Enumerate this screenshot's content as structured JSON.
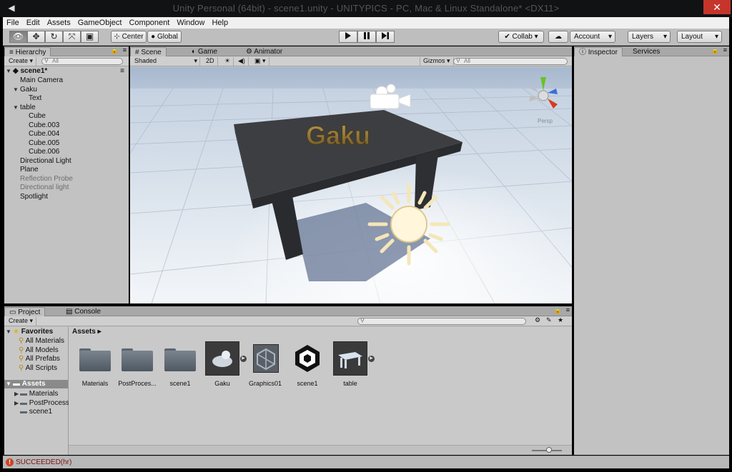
{
  "window": {
    "title": "Unity Personal (64bit) - scene1.unity - UNITYPICS - PC, Mac & Linux Standalone* <DX11>",
    "close_glyph": "✕",
    "app_icon": "unity-icon"
  },
  "menu": [
    "File",
    "Edit",
    "Assets",
    "GameObject",
    "Component",
    "Window",
    "Help"
  ],
  "toolbar": {
    "tools": [
      "hand-icon",
      "move-icon",
      "rotate-icon",
      "scale-icon",
      "rect-icon"
    ],
    "pivot": "Center",
    "space": "Global",
    "play_icon": "play-icon",
    "pause_icon": "pause-icon",
    "step_icon": "step-icon",
    "collab": "Collab ▾",
    "cloud_icon": "cloud-icon",
    "account": "Account",
    "layers": "Layers",
    "layout": "Layout"
  },
  "hierarchy": {
    "tab": "Hierarchy",
    "create": "Create",
    "search_placeholder": "All",
    "scene_name": "scene1*",
    "items": [
      {
        "label": "Main Camera",
        "depth": 1,
        "expander": "",
        "dim": false
      },
      {
        "label": "Gaku",
        "depth": 1,
        "expander": "▼",
        "dim": false
      },
      {
        "label": "Text",
        "depth": 2,
        "expander": "",
        "dim": false
      },
      {
        "label": "table",
        "depth": 1,
        "expander": "▼",
        "dim": false
      },
      {
        "label": "Cube",
        "depth": 2,
        "expander": "",
        "dim": false
      },
      {
        "label": "Cube.003",
        "depth": 2,
        "expander": "",
        "dim": false
      },
      {
        "label": "Cube.004",
        "depth": 2,
        "expander": "",
        "dim": false
      },
      {
        "label": "Cube.005",
        "depth": 2,
        "expander": "",
        "dim": false
      },
      {
        "label": "Cube.006",
        "depth": 2,
        "expander": "",
        "dim": false
      },
      {
        "label": "Directional Light",
        "depth": 1,
        "expander": "",
        "dim": false
      },
      {
        "label": "Plane",
        "depth": 1,
        "expander": "",
        "dim": false
      },
      {
        "label": "Reflection Probe",
        "depth": 1,
        "expander": "",
        "dim": true
      },
      {
        "label": "Directional light",
        "depth": 1,
        "expander": "",
        "dim": true
      },
      {
        "label": "Spotlight",
        "depth": 1,
        "expander": "",
        "dim": false
      }
    ]
  },
  "scene": {
    "tabs": [
      "Scene",
      "Game",
      "Animator"
    ],
    "shading": "Shaded",
    "mode_2d": "2D",
    "gizmos": "Gizmos",
    "search_placeholder": "All",
    "persp_label": "Persp",
    "text_3d": "Gaku"
  },
  "inspector": {
    "tabs": [
      "Inspector",
      "Services"
    ]
  },
  "project": {
    "tabs": [
      "Project",
      "Console"
    ],
    "create": "Create",
    "favorites": {
      "title": "Favorites",
      "items": [
        "All Materials",
        "All Models",
        "All Prefabs",
        "All Scripts"
      ]
    },
    "assets_tree": {
      "title": "Assets",
      "items": [
        "Materials",
        "PostProcess",
        "scene1"
      ]
    },
    "breadcrumb": "Assets ▸",
    "assets": [
      {
        "label": "Materials",
        "kind": "folder"
      },
      {
        "label": "PostProces...",
        "kind": "folder"
      },
      {
        "label": "scene1",
        "kind": "folder"
      },
      {
        "label": "Gaku",
        "kind": "model"
      },
      {
        "label": "Graphics01",
        "kind": "shader"
      },
      {
        "label": "scene1",
        "kind": "unity-scene"
      },
      {
        "label": "table",
        "kind": "model"
      }
    ]
  },
  "status": {
    "message": "SUCCEEDED(hr)",
    "icon": "error-icon"
  }
}
